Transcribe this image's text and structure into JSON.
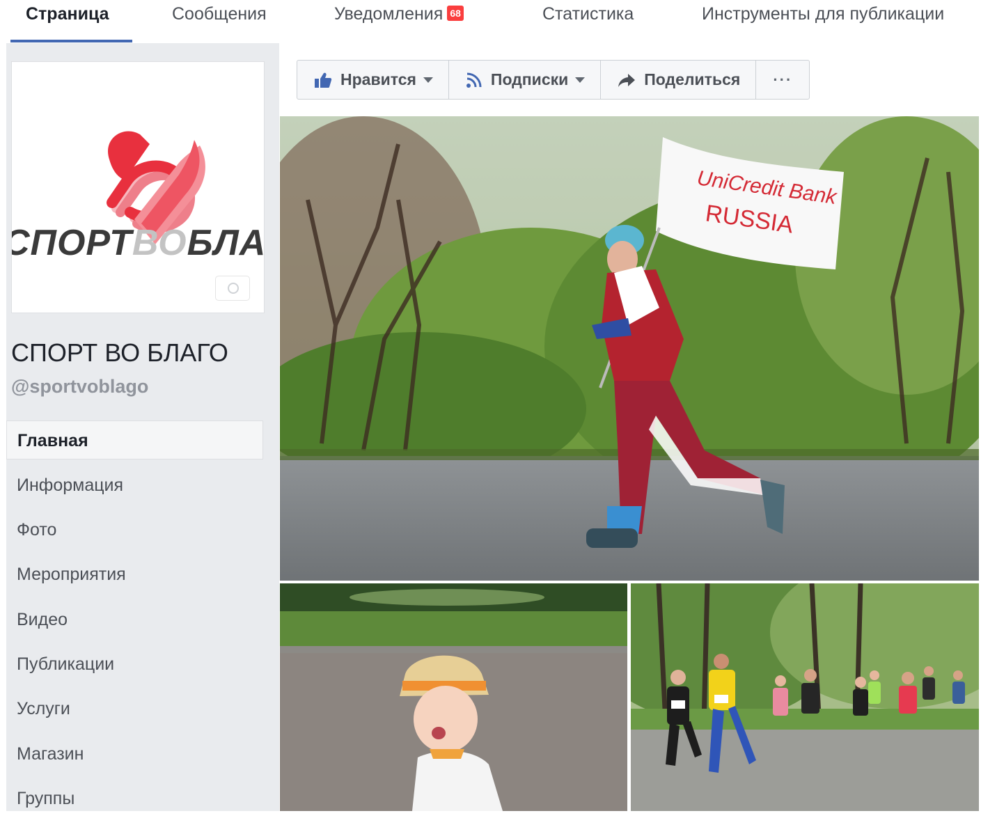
{
  "nav": {
    "tabs": [
      {
        "label": "Страница"
      },
      {
        "label": "Сообщения"
      },
      {
        "label": "Уведомления",
        "badge": "68"
      },
      {
        "label": "Статистика"
      },
      {
        "label": "Инструменты для публикации"
      }
    ]
  },
  "profile": {
    "logo_text_dark": "СПОРТ",
    "logo_text_light": "ВО",
    "logo_text_dark2": "БЛАГО",
    "name": "СПОРТ ВО БЛАГО",
    "handle": "@sportvoblago"
  },
  "sidebar": {
    "items": [
      {
        "label": "Главная"
      },
      {
        "label": "Информация"
      },
      {
        "label": "Фото"
      },
      {
        "label": "Мероприятия"
      },
      {
        "label": "Видео"
      },
      {
        "label": "Публикации"
      },
      {
        "label": "Услуги"
      },
      {
        "label": "Магазин"
      },
      {
        "label": "Группы"
      }
    ]
  },
  "actions": {
    "like": "Нравится",
    "follow": "Подписки",
    "share": "Поделиться",
    "more": "···"
  },
  "photos": {
    "flag_line1": "UniCredit Bank",
    "flag_line2": "RUSSIA"
  },
  "colors": {
    "accent": "#4267b2",
    "badge": "#fa3e3e",
    "logo_red": "#e8303e"
  }
}
